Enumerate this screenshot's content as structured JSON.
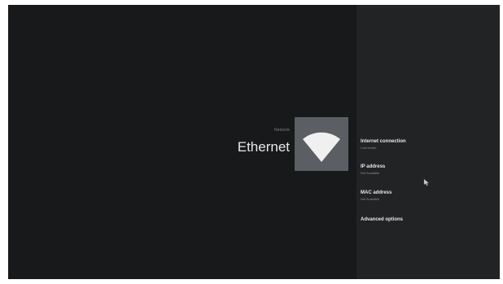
{
  "header": {
    "breadcrumb": "Network",
    "title": "Ethernet"
  },
  "icon": {
    "name": "wifi-icon"
  },
  "details": [
    {
      "title": "Internet connection",
      "subtitle": "Connected"
    },
    {
      "title": "IP address",
      "subtitle": "Not Available"
    },
    {
      "title": "MAC address",
      "subtitle": "Not Available"
    },
    {
      "title": "Advanced options",
      "subtitle": ""
    }
  ],
  "colors": {
    "background": "#18191b",
    "panel": "#222324",
    "icon_tile": "#5b5f64",
    "text_primary": "#e7e8e9",
    "text_secondary": "#8a8c8f"
  }
}
